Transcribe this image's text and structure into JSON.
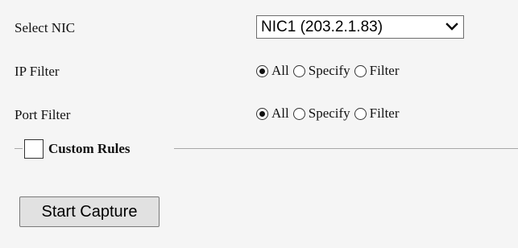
{
  "nic": {
    "label": "Select NIC",
    "selected": "NIC1 (203.2.1.83)",
    "icon": "chevron-down-icon"
  },
  "ip_filter": {
    "label": "IP Filter",
    "selected": "All",
    "options": [
      "All",
      "Specify",
      "Filter"
    ]
  },
  "port_filter": {
    "label": "Port Filter",
    "selected": "All",
    "options": [
      "All",
      "Specify",
      "Filter"
    ]
  },
  "custom_rules": {
    "label": "Custom Rules",
    "checked": false
  },
  "start_capture": {
    "label": "Start Capture"
  },
  "colors": {
    "background": "#f5f5f5",
    "button": "#e1e1e1"
  }
}
